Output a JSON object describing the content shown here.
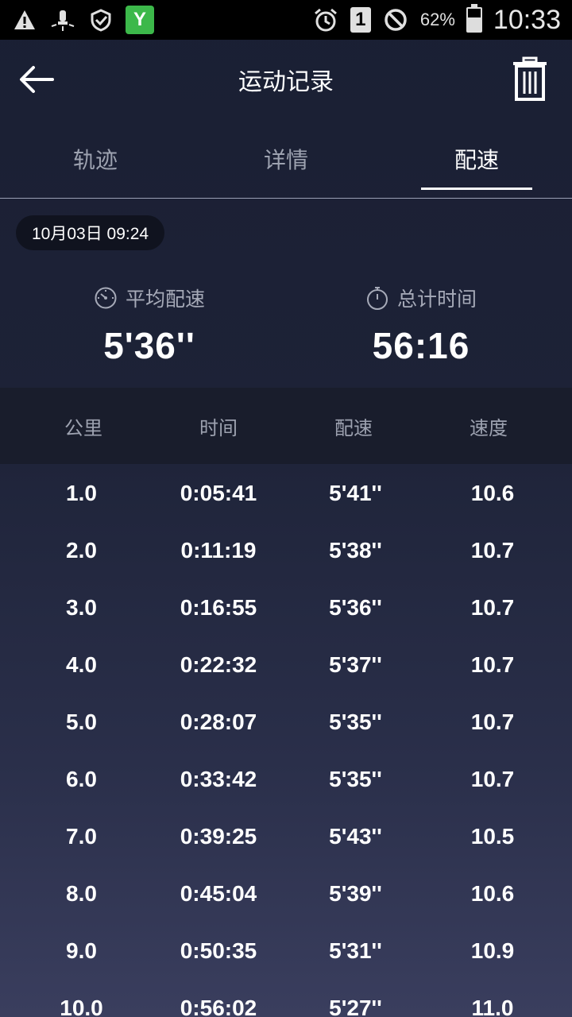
{
  "status_bar": {
    "battery_text": "62%",
    "battery_level": 0.62,
    "clock": "10:33",
    "sim_slot": "1",
    "icons": [
      "warning-icon",
      "bulb-icon",
      "shield-icon",
      "app-badge-icon",
      "alarm-icon",
      "sim-icon",
      "no-disturb-icon",
      "battery-icon"
    ]
  },
  "header": {
    "title": "运动记录"
  },
  "tabs": [
    {
      "label": "轨迹",
      "active": false
    },
    {
      "label": "详情",
      "active": false
    },
    {
      "label": "配速",
      "active": true
    }
  ],
  "date": "10月03日 09:24",
  "summary": {
    "avg_pace_label": "平均配速",
    "avg_pace_value": "5'36''",
    "total_time_label": "总计时间",
    "total_time_value": "56:16"
  },
  "table": {
    "headers": [
      "公里",
      "时间",
      "配速",
      "速度"
    ],
    "rows": [
      [
        "1.0",
        "0:05:41",
        "5'41''",
        "10.6"
      ],
      [
        "2.0",
        "0:11:19",
        "5'38''",
        "10.7"
      ],
      [
        "3.0",
        "0:16:55",
        "5'36''",
        "10.7"
      ],
      [
        "4.0",
        "0:22:32",
        "5'37''",
        "10.7"
      ],
      [
        "5.0",
        "0:28:07",
        "5'35''",
        "10.7"
      ],
      [
        "6.0",
        "0:33:42",
        "5'35''",
        "10.7"
      ],
      [
        "7.0",
        "0:39:25",
        "5'43''",
        "10.5"
      ],
      [
        "8.0",
        "0:45:04",
        "5'39''",
        "10.6"
      ],
      [
        "9.0",
        "0:50:35",
        "5'31''",
        "10.9"
      ],
      [
        "10.0",
        "0:56:02",
        "5'27''",
        "11.0"
      ]
    ]
  },
  "colors": {
    "background_top": "#1a1f33",
    "background_bottom": "#3a3e5e",
    "tab_inactive": "#9da2b0",
    "app_badge": "#3cb84a"
  }
}
